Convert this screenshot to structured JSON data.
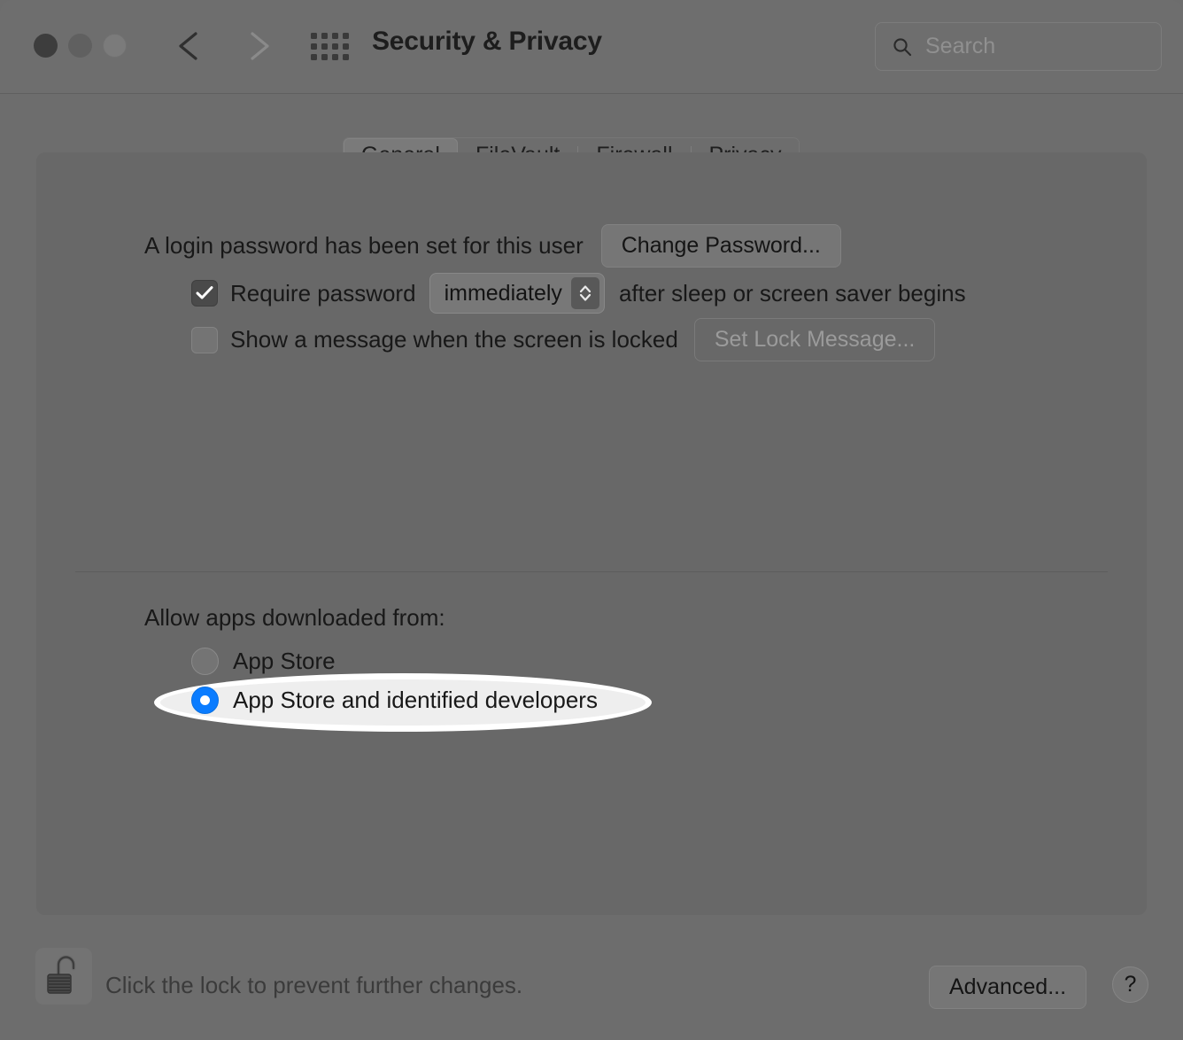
{
  "window": {
    "title": "Security & Privacy",
    "traffic_lights": [
      "close-button",
      "minimize-button",
      "zoom-button"
    ],
    "nav": {
      "back": "back-chevron",
      "forward": "forward-chevron"
    },
    "grid_button": "show-all-preferences",
    "search": {
      "placeholder": "Search",
      "value": "",
      "icon": "search-icon"
    }
  },
  "tabs": [
    {
      "label": "General",
      "selected": true
    },
    {
      "label": "FileVault",
      "selected": false
    },
    {
      "label": "Firewall",
      "selected": false
    },
    {
      "label": "Privacy",
      "selected": false
    }
  ],
  "general": {
    "password_status": "A login password has been set for this user",
    "change_password_button": "Change Password...",
    "require_password": {
      "checked": true,
      "label_before": "Require password",
      "popup_value": "immediately",
      "label_after": "after sleep or screen saver begins"
    },
    "lock_message": {
      "checked": false,
      "label": "Show a message when the screen is locked",
      "button": "Set Lock Message...",
      "button_disabled": true
    },
    "allow_apps": {
      "heading": "Allow apps downloaded from:",
      "options": [
        {
          "label": "App Store",
          "selected": false
        },
        {
          "label": "App Store and identified developers",
          "selected": true
        }
      ],
      "highlight_on_option": 1
    }
  },
  "bottom_bar": {
    "lock_icon": "open-padlock-icon",
    "lock_caption": "Click the lock to prevent further changes.",
    "advanced_button": "Advanced...",
    "help_button": "?"
  },
  "colors": {
    "accent_blue": "#0a7cff",
    "window_background": "#6d6d6d",
    "panel_background": "#686868",
    "highlight_ring": "#ffffff",
    "highlight_fill": "#eeeeee",
    "text_primary": "#181818",
    "text_disabled": "#9a9a9a"
  }
}
